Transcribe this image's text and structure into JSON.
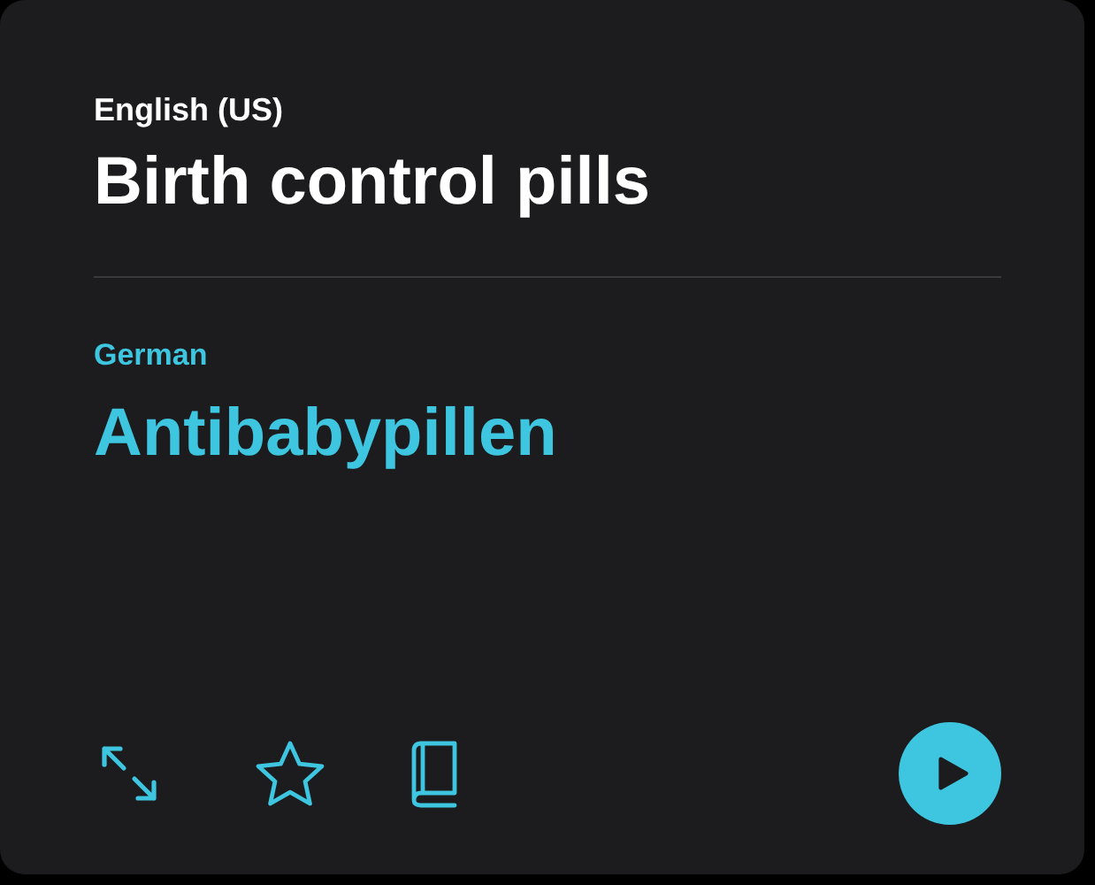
{
  "source": {
    "language": "English (US)",
    "text": "Birth control pills"
  },
  "target": {
    "language": "German",
    "text": "Antibabypillen"
  },
  "favorited": false
}
